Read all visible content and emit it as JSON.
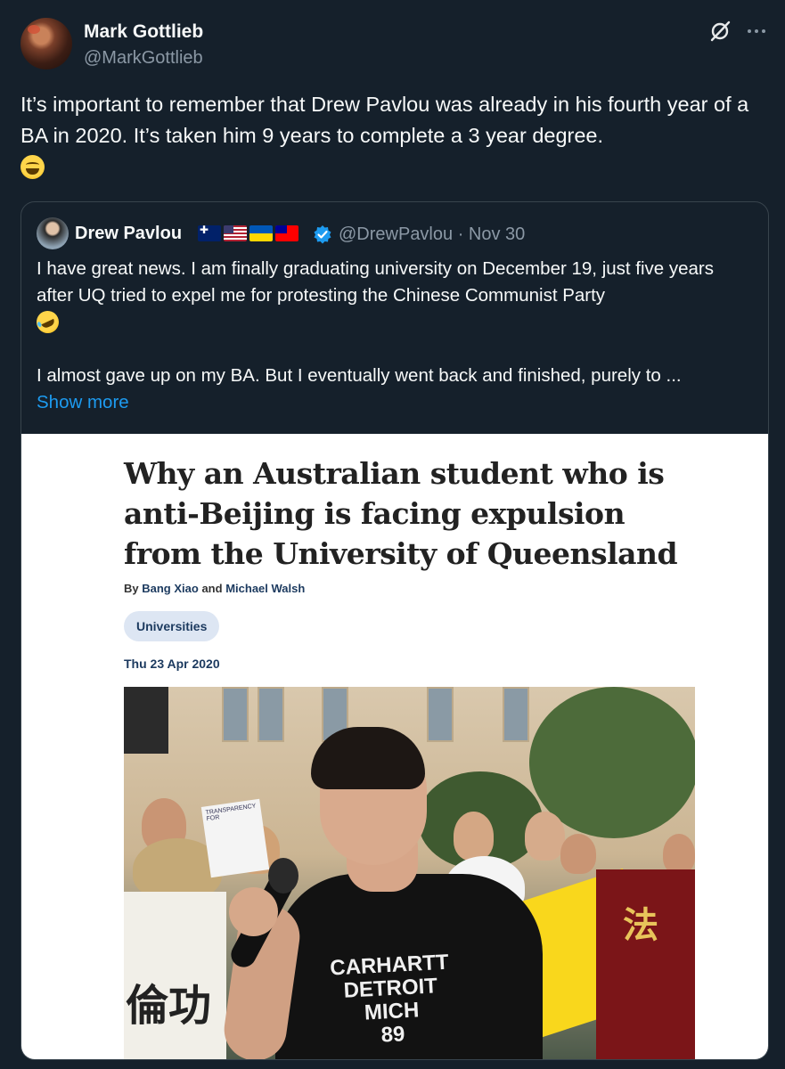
{
  "author": {
    "name": "Mark Gottlieb",
    "handle": "@MarkGottlieb"
  },
  "tweet": {
    "text": "It’s important to remember that Drew Pavlou was already in his fourth year of a BA in 2020. It’s taken him 9 years to complete a 3 year degree."
  },
  "icons": {
    "grok": "grok-icon",
    "more": "more-icon",
    "verified": "verified-badge-icon",
    "emoji_main": "grinning-squinting-face",
    "emoji_quote": "rolling-on-floor-laughing"
  },
  "quote": {
    "name": "Drew Pavlou",
    "flags": [
      "australia-flag",
      "usa-flag",
      "ukraine-flag",
      "taiwan-flag"
    ],
    "handle": "@DrewPavlou",
    "separator": "·",
    "date": "Nov 30",
    "para1": "I have great news. I am finally graduating university on December 19, just five years after UQ tried to expel me for protesting the Chinese Communist Party",
    "para2": "I almost gave up on my BA. But I eventually went back and finished, purely to ...",
    "show_more": "Show more"
  },
  "article": {
    "title": "Why an Australian student who is anti-Beijing is facing expulsion from the University of Queensland",
    "by": "By",
    "author1": "Bang Xiao",
    "and": "and",
    "author2": "Michael Walsh",
    "tag": "Universities",
    "date": "Thu 23 Apr 2020"
  },
  "photo": {
    "shirt_line1": "CARHARTT",
    "shirt_line2": "DETROIT",
    "shirt_line3": "MICH",
    "shirt_line4": "89",
    "sign_text": "TRANSPARENCY FOR",
    "banner_left_text": "倫功",
    "banner_right_text": "法"
  },
  "colors": {
    "background": "#15202b",
    "text": "#f7f9f9",
    "secondary": "#8b98a5",
    "link": "#1d9bf0",
    "border": "#38444d"
  }
}
